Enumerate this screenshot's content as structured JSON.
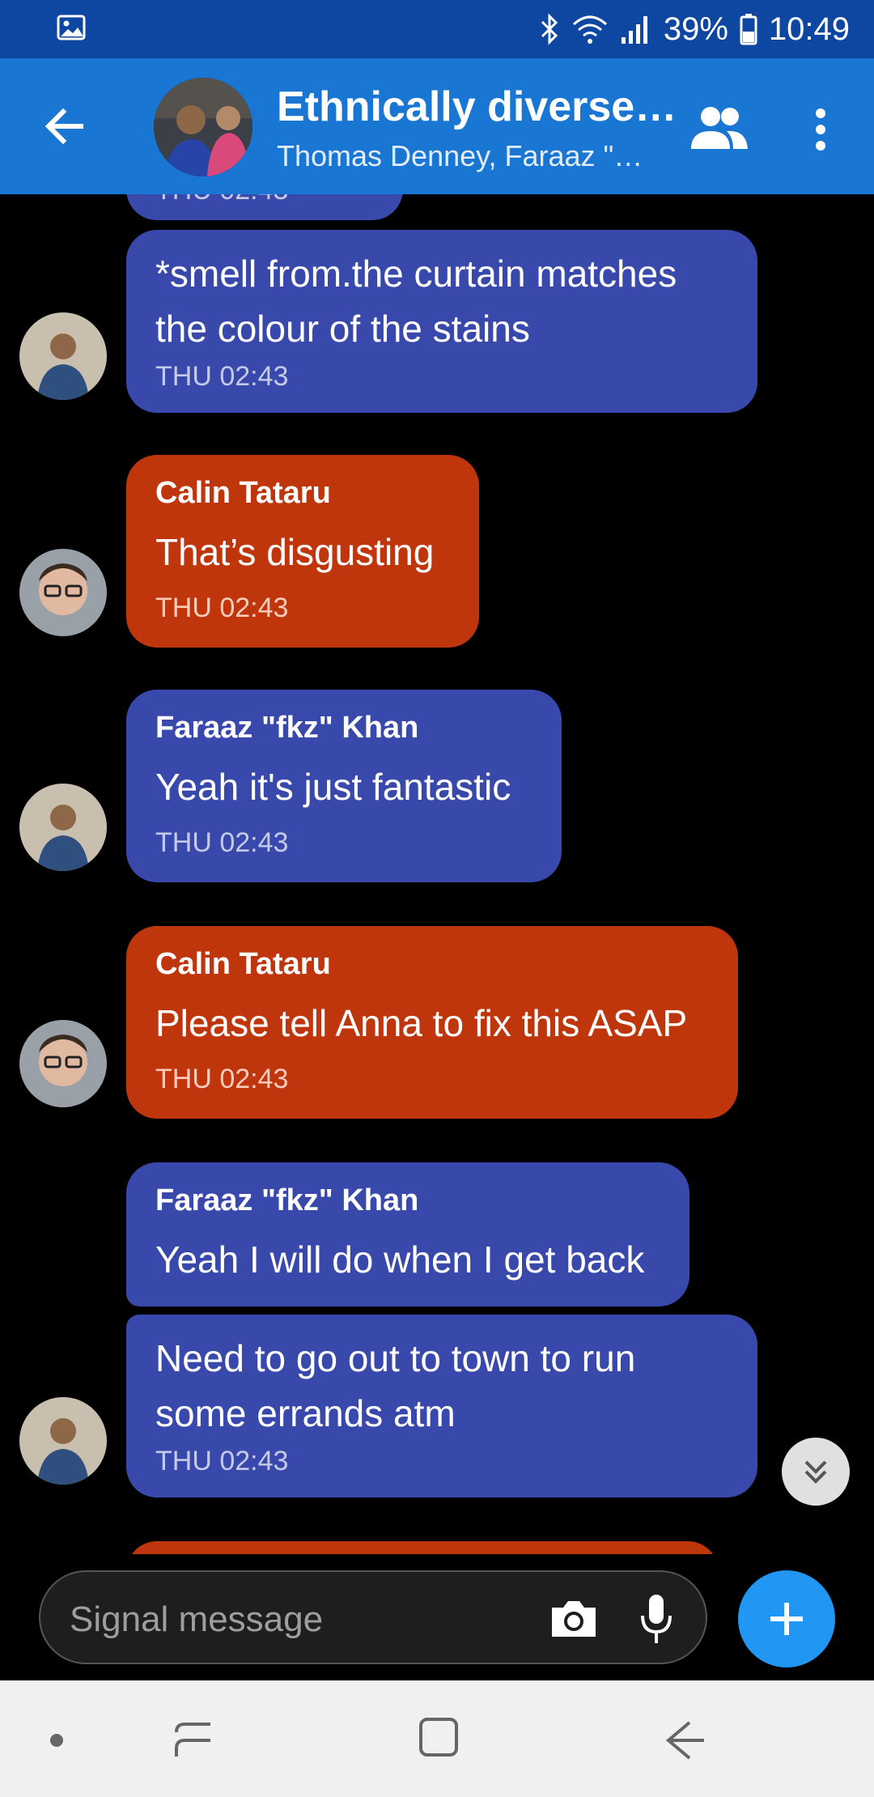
{
  "status_bar": {
    "battery": "39%",
    "time": "10:49",
    "icons": [
      "image-icon",
      "bluetooth-icon",
      "wifi-icon",
      "signal-icon",
      "battery-icon"
    ]
  },
  "header": {
    "title": "Ethnically diverse…",
    "subtitle": "Thomas Denney, Faraaz \"…"
  },
  "chat": {
    "partial_top_time": "THU 02:43",
    "messages": [
      {
        "sender": "",
        "text": "*smell from.the curtain matches the colour of the stains",
        "time": "THU 02:43",
        "color": "#3949ab"
      },
      {
        "sender": "Calin Tataru",
        "text": "That’s disgusting",
        "time": "THU 02:43",
        "color": "#bf360c"
      },
      {
        "sender": "Faraaz \"fkz\" Khan",
        "text": "Yeah it's just fantastic",
        "time": "THU 02:43",
        "color": "#3949ab"
      },
      {
        "sender": "Calin Tataru",
        "text": "Please tell Anna to fix this ASAP",
        "time": "THU 02:43",
        "color": "#bf360c"
      },
      {
        "sender": "Faraaz \"fkz\" Khan",
        "text": "Yeah I will do when I get back",
        "time": "",
        "color": "#3949ab"
      },
      {
        "sender": "",
        "text": "Need to go out to town to run some errands atm",
        "time": "THU 02:43",
        "color": "#3949ab"
      }
    ]
  },
  "composer": {
    "placeholder": "Signal message"
  },
  "colors": {
    "status_bar": "#0d47a1",
    "app_bar": "#1976d2",
    "outgoing_blue": "#3949ab",
    "incoming_red": "#bf360c",
    "accent": "#2196f3"
  }
}
